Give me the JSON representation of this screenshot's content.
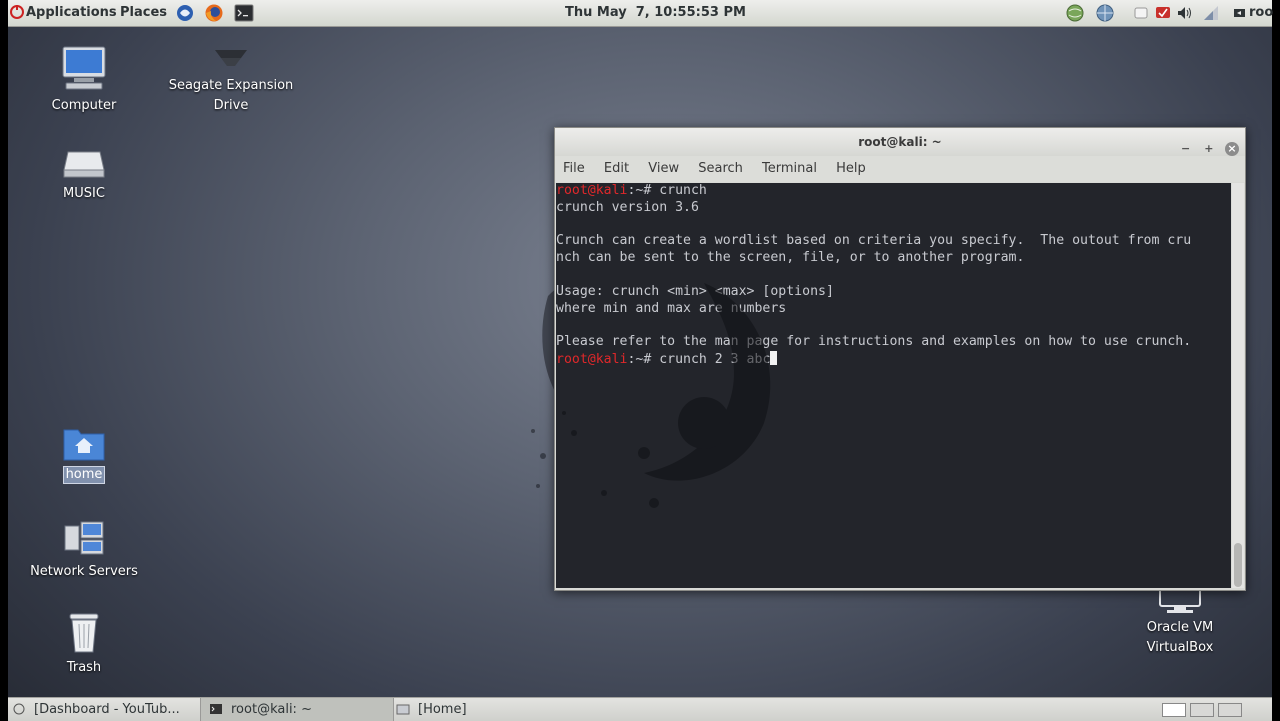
{
  "top_panel": {
    "applications_label": "Applications",
    "places_label": "Places",
    "clock": "Thu May  7, 10:55:53 PM",
    "user_label": "roo"
  },
  "desktop": {
    "icons": [
      {
        "label": "Computer"
      },
      {
        "label": "Seagate Expansion\nDrive"
      },
      {
        "label": "MUSIC"
      },
      {
        "label": "home"
      },
      {
        "label": "Network Servers"
      },
      {
        "label": "Trash"
      },
      {
        "label": "Oracle VM\nVirtualBox"
      }
    ]
  },
  "terminal": {
    "title": "root@kali: ~",
    "menu": [
      "File",
      "Edit",
      "View",
      "Search",
      "Terminal",
      "Help"
    ],
    "prompt_user": "root@kali",
    "lines": [
      {
        "prompt": true,
        "text": ":~# crunch"
      },
      {
        "prompt": false,
        "text": "crunch version 3.6"
      },
      {
        "prompt": false,
        "text": ""
      },
      {
        "prompt": false,
        "text": "Crunch can create a wordlist based on criteria you specify.  The outout from cru"
      },
      {
        "prompt": false,
        "text": "nch can be sent to the screen, file, or to another program."
      },
      {
        "prompt": false,
        "text": ""
      },
      {
        "prompt": false,
        "text": "Usage: crunch <min> <max> [options]"
      },
      {
        "prompt": false,
        "text": "where min and max are numbers"
      },
      {
        "prompt": false,
        "text": ""
      },
      {
        "prompt": false,
        "text": "Please refer to the man page for instructions and examples on how to use crunch."
      },
      {
        "prompt": true,
        "text": ":~# crunch 2 3 abc",
        "cursor": true
      }
    ]
  },
  "taskbar": {
    "tasks": [
      {
        "label": "[Dashboard - YouTub..."
      },
      {
        "label": "root@kali: ~"
      },
      {
        "label": "[Home]"
      }
    ]
  },
  "colors": {
    "prompt_red": "#e0282a",
    "terminal_bg": "#23252b",
    "panel_bg": "#e6e6e3"
  }
}
